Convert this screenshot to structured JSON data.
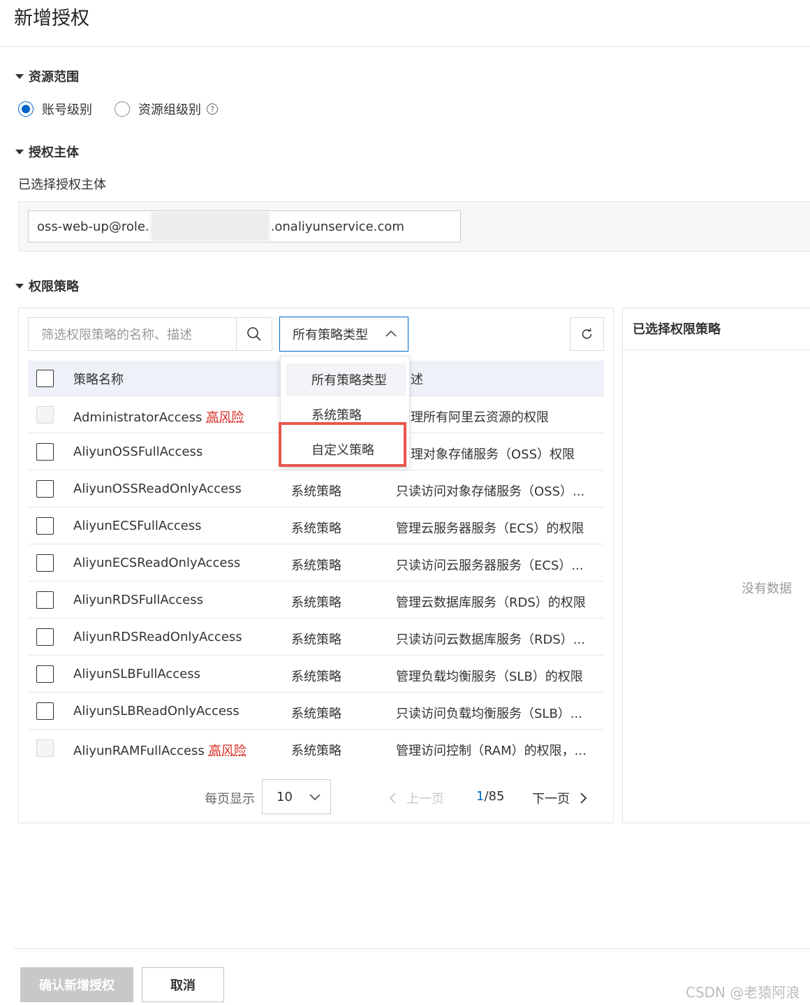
{
  "page": {
    "title": "新增授权"
  },
  "sections": {
    "resource_scope": "资源范围",
    "principal": "授权主体",
    "policy": "权限策略"
  },
  "resource_scope": {
    "options": [
      {
        "label": "账号级别",
        "checked": true
      },
      {
        "label": "资源组级别",
        "checked": false
      }
    ]
  },
  "principal": {
    "selected_label": "已选择授权主体",
    "value_prefix": "oss-web-up@role.",
    "value_suffix": ".onaliyunservice.com"
  },
  "policy": {
    "search_placeholder": "筛选权限策略的名称、描述",
    "type_select": "所有策略类型",
    "columns": {
      "name": "策略名称",
      "desc": "述"
    },
    "dropdown_items": [
      "所有策略类型",
      "系统策略",
      "自定义策略"
    ],
    "rows": [
      {
        "name": "AdministratorAccess",
        "risk": "高风险",
        "type": "",
        "desc": "理所有阿里云资源的权限",
        "disabled": true
      },
      {
        "name": "AliyunOSSFullAccess",
        "risk": "",
        "type": "",
        "desc": "理对象存储服务（OSS）权限",
        "disabled": false
      },
      {
        "name": "AliyunOSSReadOnlyAccess",
        "risk": "",
        "type": "系统策略",
        "desc": "只读访问对象存储服务（OSS）...",
        "disabled": false
      },
      {
        "name": "AliyunECSFullAccess",
        "risk": "",
        "type": "系统策略",
        "desc": "管理云服务器服务（ECS）的权限",
        "disabled": false
      },
      {
        "name": "AliyunECSReadOnlyAccess",
        "risk": "",
        "type": "系统策略",
        "desc": "只读访问云服务器服务（ECS）...",
        "disabled": false
      },
      {
        "name": "AliyunRDSFullAccess",
        "risk": "",
        "type": "系统策略",
        "desc": "管理云数据库服务（RDS）的权限",
        "disabled": false
      },
      {
        "name": "AliyunRDSReadOnlyAccess",
        "risk": "",
        "type": "系统策略",
        "desc": "只读访问云数据库服务（RDS）...",
        "disabled": false
      },
      {
        "name": "AliyunSLBFullAccess",
        "risk": "",
        "type": "系统策略",
        "desc": "管理负载均衡服务（SLB）的权限",
        "disabled": false
      },
      {
        "name": "AliyunSLBReadOnlyAccess",
        "risk": "",
        "type": "系统策略",
        "desc": "只读访问负载均衡服务（SLB）...",
        "disabled": false
      },
      {
        "name": "AliyunRAMFullAccess",
        "risk": "高风险",
        "type": "系统策略",
        "desc": "管理访问控制（RAM）的权限，...",
        "disabled": true
      }
    ],
    "pagination": {
      "per_page_label": "每页显示",
      "per_page": "10",
      "prev": "上一页",
      "current": "1",
      "total": "/85",
      "next": "下一页"
    }
  },
  "selected": {
    "title": "已选择权限策略",
    "empty": "没有数据"
  },
  "footer": {
    "confirm": "确认新增授权",
    "cancel": "取消"
  },
  "watermark": "CSDN @老猿阿浪",
  "colors": {
    "accent": "#0064c8",
    "risk": "#d93026",
    "highlight": "#e8574c"
  }
}
